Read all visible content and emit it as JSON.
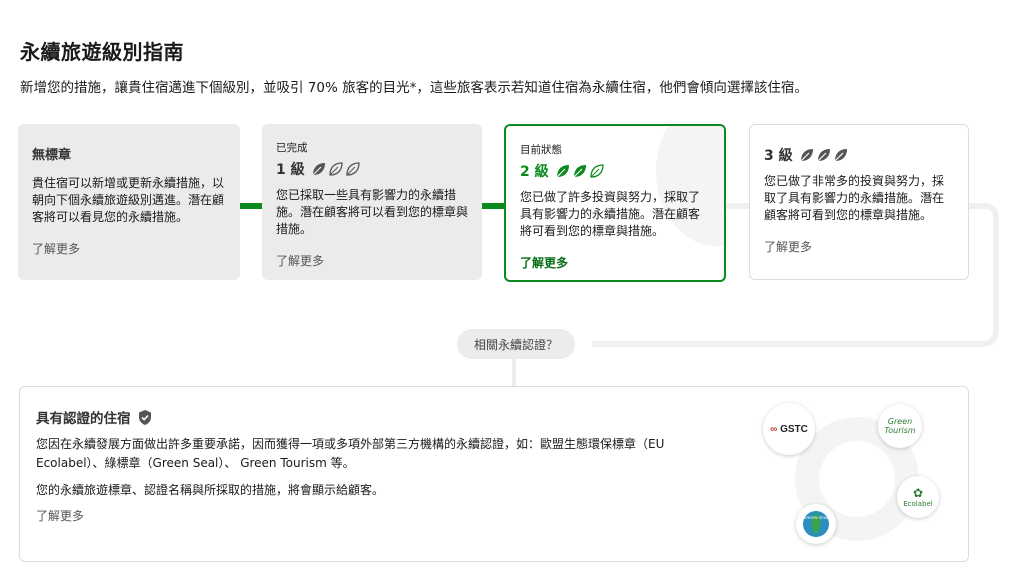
{
  "header": {
    "title": "永續旅遊級別指南",
    "subtitle": "新增您的措施，讓貴住宿邁進下個級別，並吸引 70% 旅客的目光*，這些旅客表示若知道住宿為永續住宿，他們會傾向選擇該住宿。"
  },
  "levels": {
    "none": {
      "title": "無標章",
      "desc": "貴住宿可以新增或更新永續措施，以朝向下個永續旅遊級別邁進。潛在顧客將可以看見您的永續措施。",
      "more": "了解更多"
    },
    "done": {
      "status": "已完成",
      "level": "1 級",
      "desc": "您已採取一些具有影響力的永續措施。潛在顧客將可以看到您的標章與措施。",
      "more": "了解更多"
    },
    "current": {
      "status": "目前狀態",
      "level": "2 級",
      "desc": "您已做了許多投資與努力，採取了具有影響力的永續措施。潛在顧客將可看到您的標章與措施。",
      "more": "了解更多"
    },
    "next": {
      "level": "3 級",
      "desc": "您已做了非常多的投資與努力，採取了具有影響力的永續措施。潛在顧客將可看到您的標章與措施。",
      "more": "了解更多"
    }
  },
  "bubble": {
    "label": "相關永續認證？"
  },
  "certified": {
    "title": "具有認證的住宿",
    "desc": "您因在永續發展方面做出許多重要承諾，因而獲得一項或多項外部第三方機構的永續認證，如：歐盟生態環保標章（EU Ecolabel）、綠標章（Green Seal）、 Green Tourism 等。",
    "desc2": "您的永續旅遊標章、認證名稱與所採取的措施，將會顯示給顧客。",
    "more": "了解更多",
    "logos": {
      "gstc": "GSTC",
      "green_tourism_1": "Green",
      "green_tourism_2": "Tourism",
      "ecolabel": "Ecolabel",
      "green_seal": "GREEN SEAL"
    }
  },
  "colors": {
    "accent": "#0a8a1e",
    "card_gray": "#ebebeb",
    "leaf_gray": "#555555"
  }
}
